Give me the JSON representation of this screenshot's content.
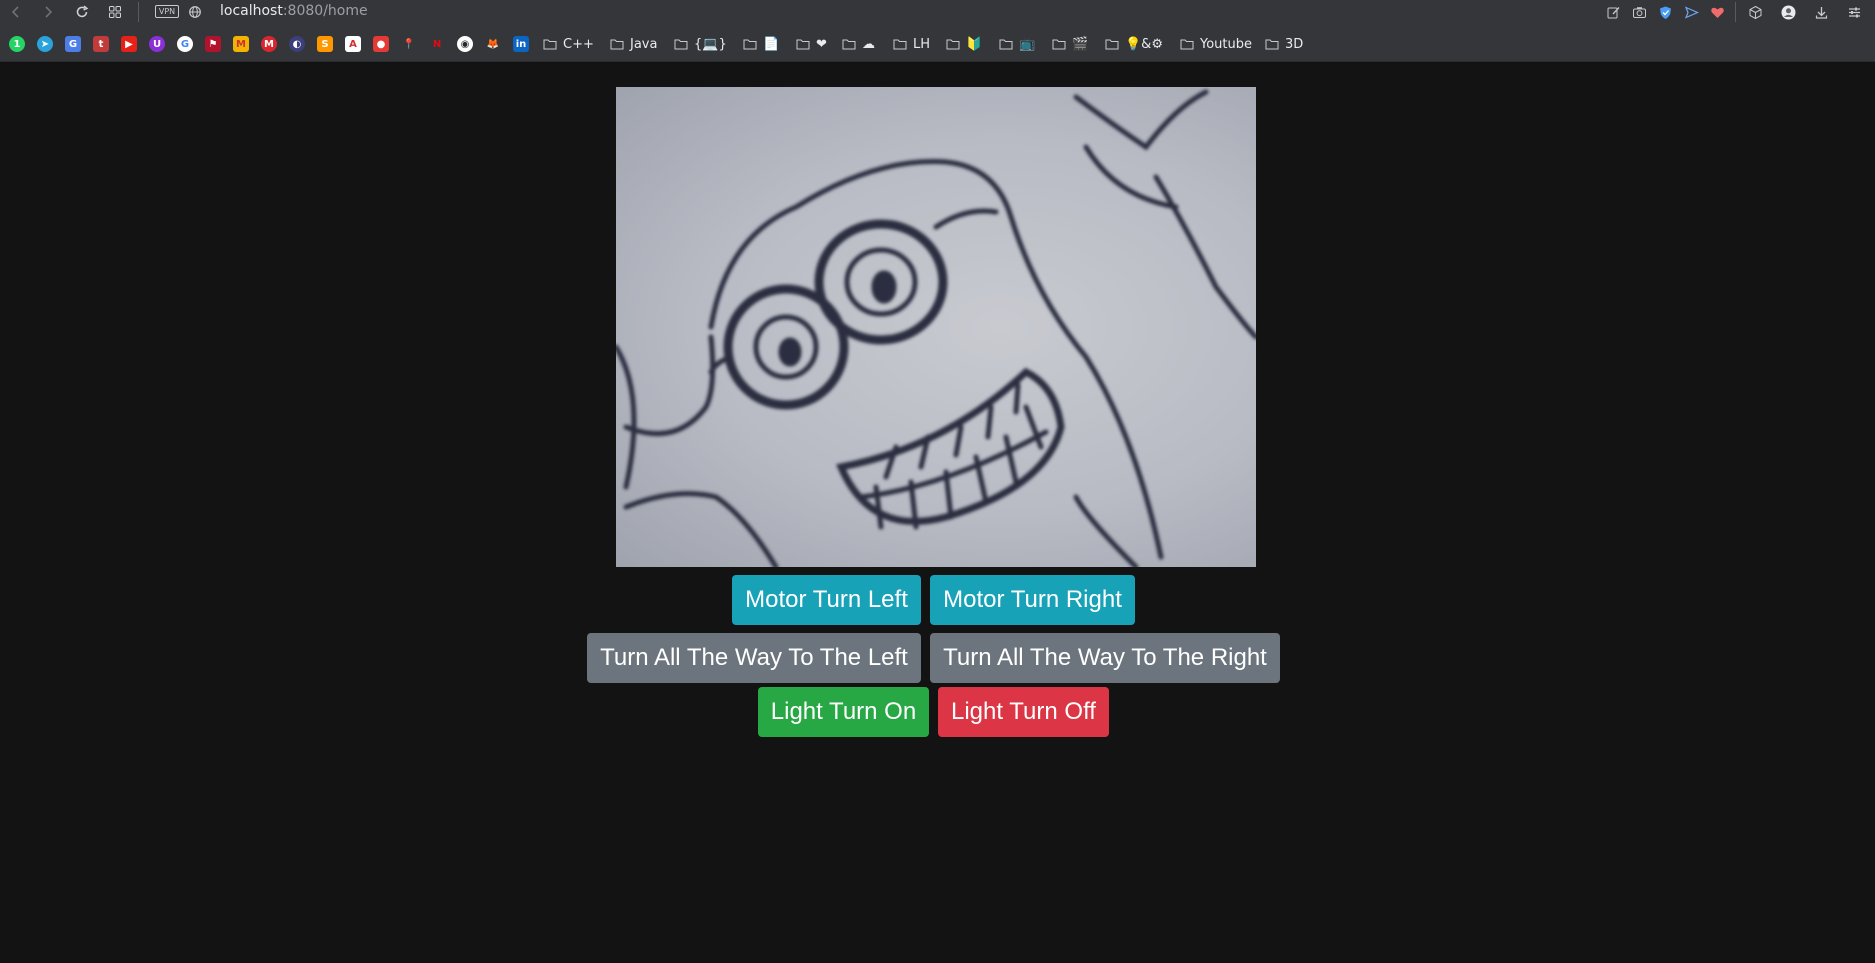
{
  "browser": {
    "vpn_label": "VPN",
    "url_host": "localhost",
    "url_path": ":8080/home"
  },
  "bookmarks": {
    "icons": [
      "whatsapp-icon",
      "telegram-icon",
      "translate-icon",
      "tumblr-icon",
      "youtube-icon",
      "ublock-icon",
      "google-icon",
      "flag-icon",
      "gmail-icon",
      "mega-icon",
      "browser-icon",
      "sublime-icon",
      "pdf-icon",
      "maps-pin-icon",
      "google-maps-icon",
      "netflix-icon",
      "github-icon",
      "gitlab-icon",
      "linkedin-icon"
    ],
    "folders": [
      {
        "label": "C++"
      },
      {
        "label": "Java"
      },
      {
        "label": "{💻}"
      },
      {
        "label": "📄"
      },
      {
        "label": "❤"
      },
      {
        "label": "☁"
      },
      {
        "label": "LH"
      },
      {
        "label": "🔰"
      },
      {
        "label": "📺"
      },
      {
        "label": "🎬"
      },
      {
        "label": "💡&⚙"
      },
      {
        "label": "Youtube"
      },
      {
        "label": "3D"
      }
    ]
  },
  "controls": {
    "motor_left": "Motor Turn Left",
    "motor_right": "Motor Turn Right",
    "full_left": "Turn All The Way To The Left",
    "full_right": "Turn All The Way To The Right",
    "light_on": "Light Turn On",
    "light_off": "Light Turn Off"
  },
  "colors": {
    "page_bg": "#131313",
    "toolbar_bg": "#35363a",
    "info": "#17a2b8",
    "secondary": "#6c757d",
    "success": "#28a745",
    "danger": "#dc3545"
  }
}
